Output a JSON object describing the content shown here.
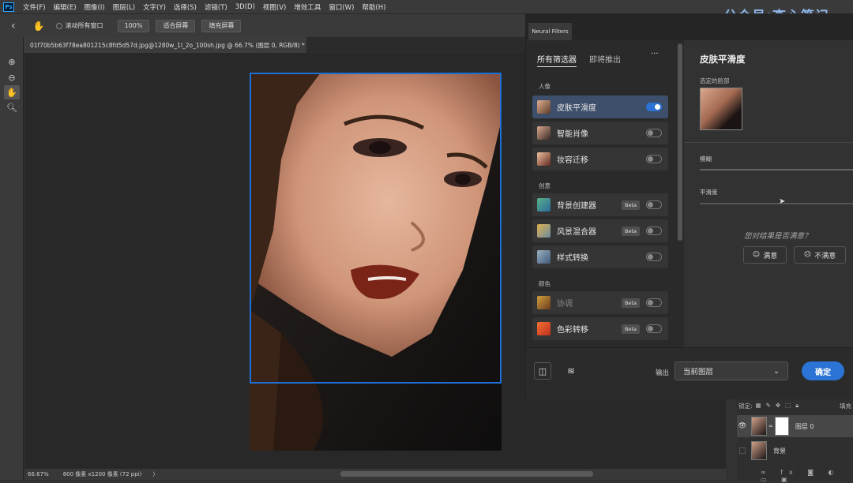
{
  "menubar": {
    "logo": "Ps",
    "items": [
      "文件(F)",
      "编辑(E)",
      "图像(I)",
      "图层(L)",
      "文字(Y)",
      "选择(S)",
      "滤镜(T)",
      "3D(D)",
      "视图(V)",
      "增效工具",
      "窗口(W)",
      "帮助(H)"
    ],
    "watermark": "公众号:查心笔记"
  },
  "options": {
    "scroll_all": "滚动所有窗口",
    "zoom100": "100%",
    "fit_screen": "适合屏幕",
    "fill_screen": "填充屏幕"
  },
  "document": {
    "tab_title": "01f70b5b63f78ea801215c8fd5d57d.jpg@1280w_1l_2o_100sh.jpg @ 66.7% (图层 0, RGB/8) *",
    "close": "×"
  },
  "status": {
    "zoom": "66.67%",
    "info": "800 像素 x1200 像素 (72 ppi)",
    "arrow": "〉"
  },
  "neural_filters": {
    "panel_tab": "Neural Filters",
    "tabs": [
      "所有筛选器",
      "即将推出"
    ],
    "more": "···",
    "categories": {
      "portrait": "人像",
      "creative": "创意",
      "color": "颜色"
    },
    "filters": [
      {
        "label": "皮肤平滑度",
        "beta": "",
        "on": true
      },
      {
        "label": "智能肖像",
        "beta": "",
        "on": false
      },
      {
        "label": "妆容迁移",
        "beta": "",
        "on": false
      },
      {
        "label": "背景创建器",
        "beta": "Beta",
        "on": false
      },
      {
        "label": "风景混合器",
        "beta": "Beta",
        "on": false
      },
      {
        "label": "样式转换",
        "beta": "",
        "on": false
      },
      {
        "label": "协调",
        "beta": "Beta",
        "on": false
      },
      {
        "label": "色彩转移",
        "beta": "Beta",
        "on": false
      }
    ],
    "detail": {
      "title": "皮肤平滑度",
      "selected_face": "选定的脸部",
      "blur_label": "模糊",
      "smooth_label": "平滑度",
      "feedback_q": "您对结果是否满意？",
      "satisfied": "满意",
      "unsatisfied": "不满意"
    },
    "output_label": "输出",
    "output_value": "当前图层",
    "confirm": "确定",
    "accent": "#2b73d4"
  },
  "layers": {
    "lock_label": "锁定:",
    "fill_label": "填充",
    "items": [
      "图层 0",
      "背景"
    ]
  }
}
